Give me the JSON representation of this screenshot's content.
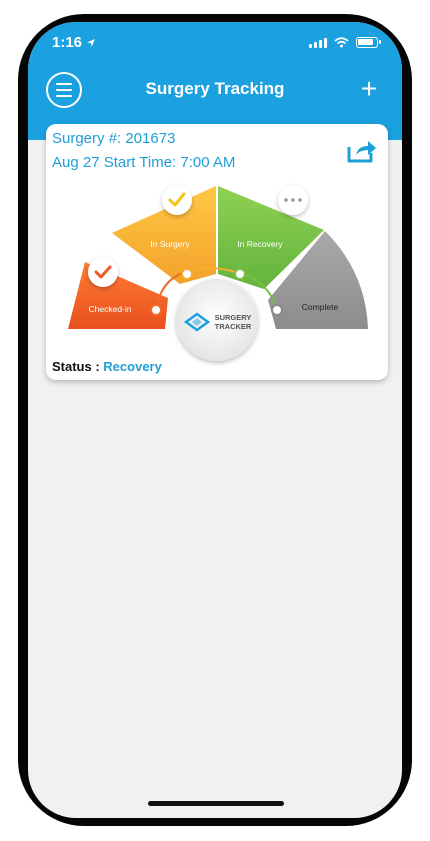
{
  "status_bar": {
    "time": "1:16"
  },
  "nav": {
    "title": "Surgery Tracking",
    "add_label": "+"
  },
  "surgery": {
    "number_line": "Surgery #: 201673",
    "date_line": "Aug 27 Start Time: 7:00 AM",
    "status_label": "Status :",
    "status_value": "Recovery"
  },
  "tracker": {
    "stages": [
      {
        "label": "Checked-in",
        "color": "#ee5a24"
      },
      {
        "label": "In Surgery",
        "color": "#f5ae2f"
      },
      {
        "label": "In Recovery",
        "color": "#76c045"
      },
      {
        "label": "Complete",
        "color": "#9c9c9c"
      }
    ],
    "logo_line1": "SURGERY",
    "logo_line2": "TRACKER",
    "colors": {
      "accent": "#1ba1e0",
      "check_red": "#ee5a24",
      "check_yellow": "#f5c518"
    }
  }
}
